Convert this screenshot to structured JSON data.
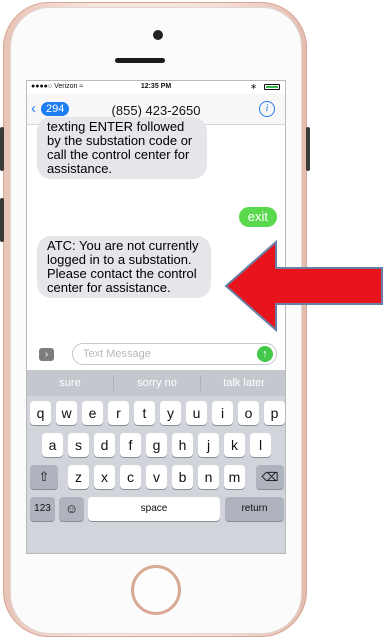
{
  "status": {
    "carrier": "●●●●○ Verizon ≈",
    "time": "12:35 PM",
    "bluetooth": "∗"
  },
  "nav": {
    "back_count": "294",
    "title": "(855) 423-2650",
    "info": "i"
  },
  "messages": {
    "m1": "texting ENTER followed by the substation code or call the control center for assistance.",
    "m2": "exit",
    "m3": "ATC: You are not currently logged in to a substation. Please contact the control center for assistance."
  },
  "compose": {
    "placeholder": "Text Message"
  },
  "suggestions": [
    "sure",
    "sorry no",
    "talk later"
  ],
  "keys": {
    "row1": [
      "q",
      "w",
      "e",
      "r",
      "t",
      "y",
      "u",
      "i",
      "o",
      "p"
    ],
    "row2": [
      "a",
      "s",
      "d",
      "f",
      "g",
      "h",
      "j",
      "k",
      "l"
    ],
    "row3": [
      "z",
      "x",
      "c",
      "v",
      "b",
      "n",
      "m"
    ],
    "numbers": "123",
    "space": "space",
    "return": "return"
  },
  "colors": {
    "accent": "#1d7ef2",
    "sent_bubble": "#5ad94e",
    "arrow": "#e8141b"
  }
}
